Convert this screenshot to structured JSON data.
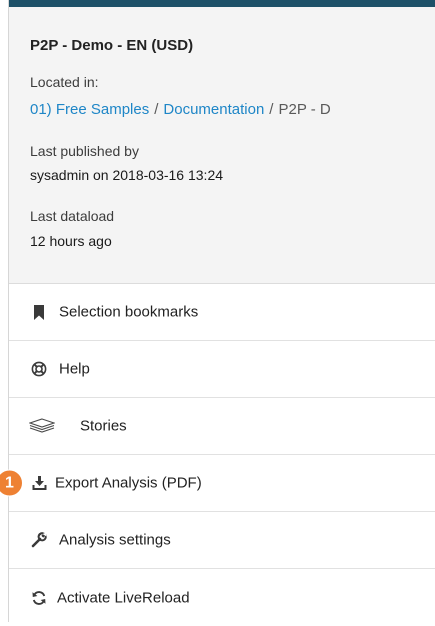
{
  "info": {
    "app_title": "P2P - Demo - EN (USD)",
    "located_label": "Located in:",
    "breadcrumb": {
      "links": [
        "01) Free Samples",
        "Documentation"
      ],
      "separator": "/",
      "current": "P2P - D"
    },
    "published_label": "Last published by",
    "published_value": "sysadmin on 2018-03-16 13:24",
    "dataload_label": "Last dataload",
    "dataload_value": "12 hours ago"
  },
  "menu": {
    "items": [
      {
        "label": "Selection bookmarks",
        "icon": "bookmark-icon"
      },
      {
        "label": "Help",
        "icon": "lifebuoy-icon"
      },
      {
        "label": "Stories",
        "icon": "stack-layers-icon"
      },
      {
        "label": "Export Analysis (PDF)",
        "icon": "download-icon"
      },
      {
        "label": "Analysis settings",
        "icon": "wrench-icon"
      },
      {
        "label": "Activate LiveReload",
        "icon": "refresh-icon"
      }
    ]
  },
  "callout": {
    "number": "1",
    "color": "#ee8133"
  },
  "colors": {
    "top_bar": "#1e5168",
    "link": "#1e86c7",
    "info_background": "#f4f4f4"
  }
}
